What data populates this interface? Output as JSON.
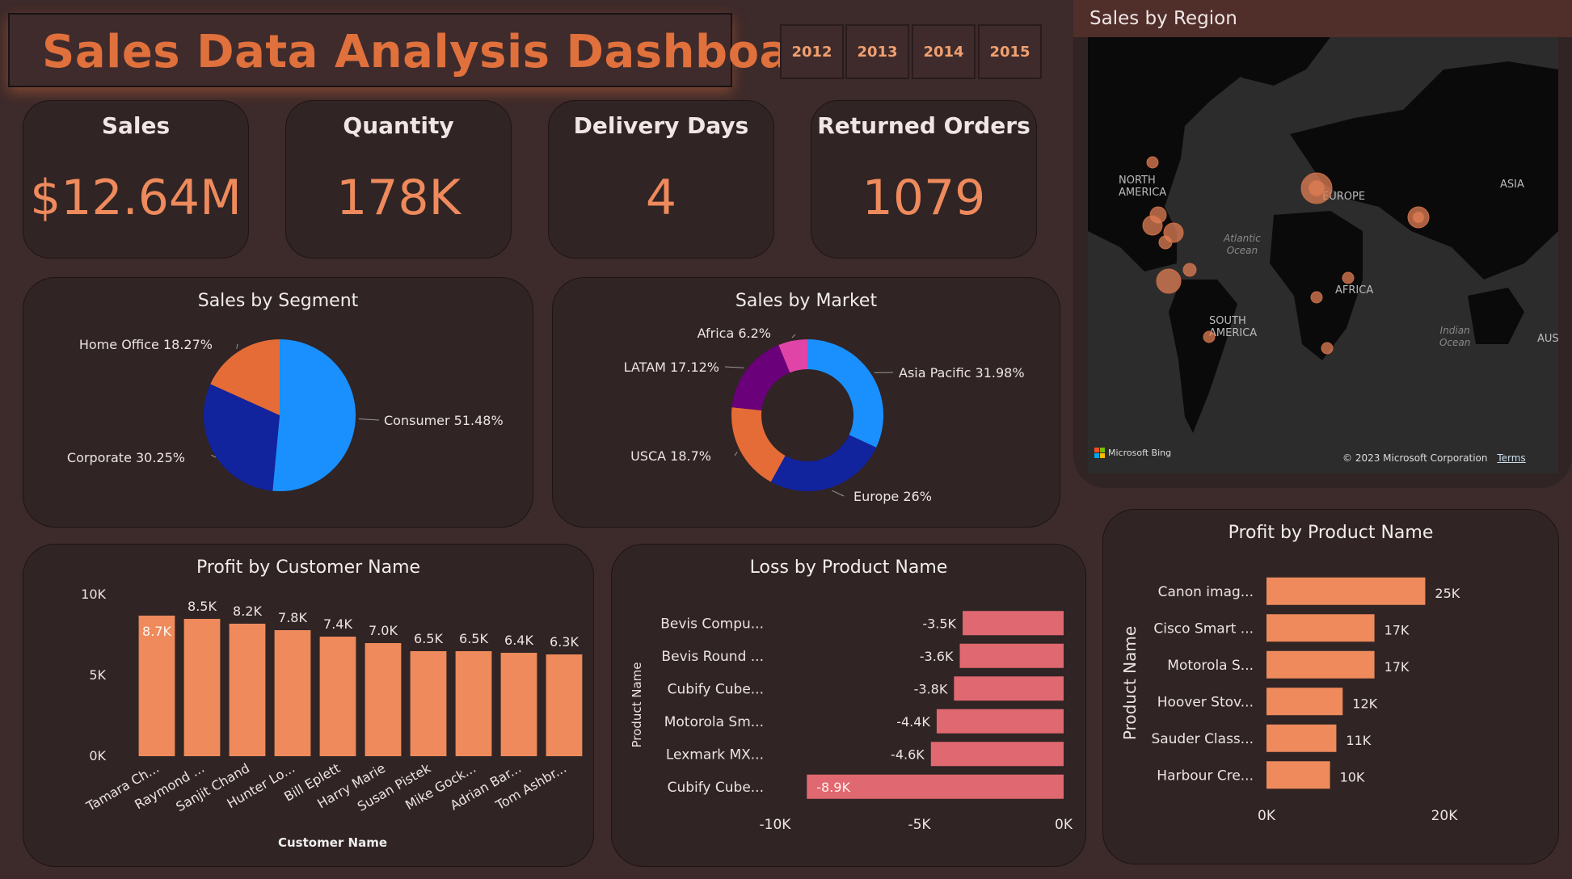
{
  "header": {
    "title": "Sales Data Analysis Dashboard",
    "years": [
      "2012",
      "2013",
      "2014",
      "2015"
    ]
  },
  "kpis": [
    {
      "label": "Sales",
      "value": "$12.64M"
    },
    {
      "label": "Quantity",
      "value": "178K"
    },
    {
      "label": "Delivery Days",
      "value": "4"
    },
    {
      "label": "Returned Orders",
      "value": "1079"
    }
  ],
  "region": {
    "title": "Sales by Region",
    "labels": {
      "north_america": "NORTH\nAMERICA",
      "europe": "EUROPE",
      "asia": "ASIA",
      "africa": "AFRICA",
      "south_america": "SOUTH\nAMERICA",
      "atlantic": "Atlantic\nOcean",
      "indian": "Indian\nOcean",
      "aus": "AUS"
    },
    "brand": "Microsoft Bing",
    "copyright": "© 2023 Microsoft Corporation",
    "terms": "Terms"
  },
  "colors": {
    "accent": "#e0703c",
    "bar": "#ee8a5c",
    "loss_bar": "#e06870",
    "bg": "#3d2a2a",
    "card": "#302424"
  },
  "chart_data": [
    {
      "id": "segment",
      "type": "pie",
      "title": "Sales by Segment",
      "slices": [
        {
          "label": "Consumer 51.48%",
          "value": 51.48,
          "color": "#1a90ff"
        },
        {
          "label": "Corporate 30.25%",
          "value": 30.25,
          "color": "#12239e"
        },
        {
          "label": "Home Office 18.27%",
          "value": 18.27,
          "color": "#e66c37"
        }
      ]
    },
    {
      "id": "market",
      "type": "pie",
      "title": "Sales by Market",
      "slices": [
        {
          "label": "Asia Pacific 31.98%",
          "value": 31.98,
          "color": "#1a90ff"
        },
        {
          "label": "Europe 26%",
          "value": 26,
          "color": "#12239e"
        },
        {
          "label": "USCA 18.7%",
          "value": 18.7,
          "color": "#e66c37"
        },
        {
          "label": "LATAM 17.12%",
          "value": 17.12,
          "color": "#6b007b"
        },
        {
          "label": "Africa 6.2%",
          "value": 6.2,
          "color": "#e044a7"
        }
      ]
    },
    {
      "id": "customer",
      "type": "bar",
      "title": "Profit by Customer Name",
      "xlabel": "Customer Name",
      "ylabel": "",
      "categories": [
        "Tamara Ch...",
        "Raymond ...",
        "Sanjit Chand",
        "Hunter Lo...",
        "Bill Eplett",
        "Harry Marie",
        "Susan Pistek",
        "Mike Gock...",
        "Adrian Bar...",
        "Tom Ashbr..."
      ],
      "values": [
        8700,
        8500,
        8200,
        7800,
        7400,
        7000,
        6500,
        6500,
        6400,
        6300
      ],
      "value_labels": [
        "8.7K",
        "8.5K",
        "8.2K",
        "7.8K",
        "7.4K",
        "7.0K",
        "6.5K",
        "6.5K",
        "6.4K",
        "6.3K"
      ],
      "yticks": [
        "0K",
        "5K",
        "10K"
      ],
      "ylim": [
        0,
        10000
      ]
    },
    {
      "id": "loss",
      "type": "bar",
      "title": "Loss by Product Name",
      "ylabel": "Product Name",
      "xlabel": "",
      "categories": [
        "Bevis Compu...",
        "Bevis Round ...",
        "Cubify Cube...",
        "Motorola Sm...",
        "Lexmark MX...",
        "Cubify Cube..."
      ],
      "values": [
        -3500,
        -3600,
        -3800,
        -4400,
        -4600,
        -8900
      ],
      "value_labels": [
        "-3.5K",
        "-3.6K",
        "-3.8K",
        "-4.4K",
        "-4.6K",
        "-8.9K"
      ],
      "xticks": [
        "-10K",
        "-5K",
        "0K"
      ],
      "xlim": [
        -10000,
        0
      ]
    },
    {
      "id": "profit_product",
      "type": "bar",
      "title": "Profit by Product Name",
      "ylabel": "Product Name",
      "xlabel": "",
      "categories": [
        "Canon imag...",
        "Cisco Smart ...",
        "Motorola S...",
        "Hoover Stov...",
        "Sauder Class...",
        "Harbour Cre..."
      ],
      "values": [
        25000,
        17000,
        17000,
        12000,
        11000,
        10000
      ],
      "value_labels": [
        "25K",
        "17K",
        "17K",
        "12K",
        "11K",
        "10K"
      ],
      "xticks": [
        "0K",
        "20K"
      ],
      "xlim": [
        0,
        28000
      ]
    }
  ]
}
